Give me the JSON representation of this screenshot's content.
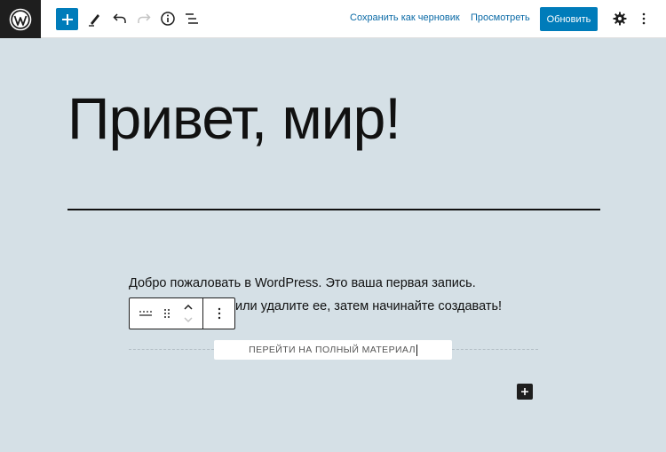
{
  "toolbar": {
    "logo_icon": "wordpress-logo-icon",
    "add_block_icon": "plus-icon",
    "tools_icon": "pencil-icon",
    "undo_icon": "undo-icon",
    "redo_icon": "redo-icon",
    "details_icon": "info-icon",
    "outline_icon": "list-view-icon",
    "save_draft_label": "Сохранить как черновик",
    "preview_label": "Просмотреть",
    "update_label": "Обновить",
    "settings_icon": "gear-icon",
    "more_icon": "kebab-menu-icon",
    "accent_color": "#007cba"
  },
  "content": {
    "title": "Привет, мир!",
    "paragraph_line1": "Добро пожаловать в WordPress. Это ваша первая запись.",
    "paragraph_line2": "или удалите ее, затем начинайте создавать!",
    "more_link_text": "ПЕРЕЙТИ НА ПОЛНЫЙ МАТЕРИАЛ",
    "background_color": "#d5e0e6"
  },
  "block_toolbar": {
    "block_type_icon": "read-more-icon",
    "drag_icon": "drag-handle-icon",
    "move_up_icon": "chevron-up-icon",
    "move_down_icon": "chevron-down-icon",
    "options_icon": "kebab-menu-icon"
  },
  "inserter_icon": "plus-icon"
}
